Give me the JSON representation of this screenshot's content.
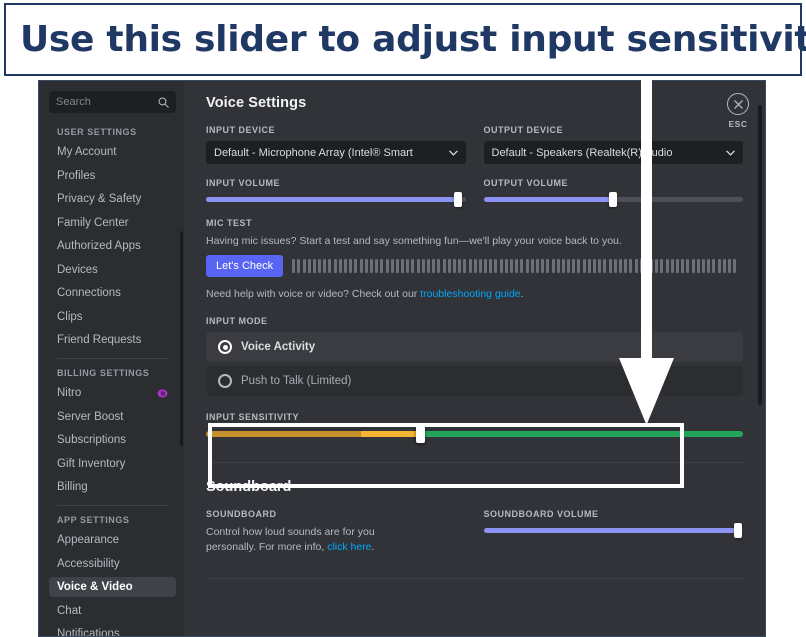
{
  "banner": {
    "text": "Use this slider to adjust input sensitivity"
  },
  "sidebar": {
    "search": {
      "placeholder": "Search",
      "icon": "search-icon"
    },
    "sections": [
      {
        "header": "USER SETTINGS",
        "items": [
          {
            "label": "My Account"
          },
          {
            "label": "Profiles"
          },
          {
            "label": "Privacy & Safety"
          },
          {
            "label": "Family Center"
          },
          {
            "label": "Authorized Apps"
          },
          {
            "label": "Devices"
          },
          {
            "label": "Connections"
          },
          {
            "label": "Clips"
          },
          {
            "label": "Friend Requests"
          }
        ]
      },
      {
        "header": "BILLING SETTINGS",
        "items": [
          {
            "label": "Nitro",
            "badge": "nitro-badge-icon"
          },
          {
            "label": "Server Boost"
          },
          {
            "label": "Subscriptions"
          },
          {
            "label": "Gift Inventory"
          },
          {
            "label": "Billing"
          }
        ]
      },
      {
        "header": "APP SETTINGS",
        "items": [
          {
            "label": "Appearance"
          },
          {
            "label": "Accessibility"
          },
          {
            "label": "Voice & Video",
            "active": true
          },
          {
            "label": "Chat"
          },
          {
            "label": "Notifications"
          }
        ]
      }
    ]
  },
  "esc": {
    "label": "ESC",
    "icon": "close-icon"
  },
  "voice": {
    "title": "Voice Settings",
    "input_device": {
      "label": "INPUT DEVICE",
      "value": "Default - Microphone Array (Intel® Smart"
    },
    "output_device": {
      "label": "OUTPUT DEVICE",
      "value": "Default - Speakers (Realtek(R) Audio"
    },
    "input_volume": {
      "label": "INPUT VOLUME",
      "percent": 97
    },
    "output_volume": {
      "label": "OUTPUT VOLUME",
      "percent": 50
    },
    "mic_test": {
      "label": "MIC TEST",
      "description": "Having mic issues? Start a test and say something fun—we'll play your voice back to you.",
      "button": "Let's Check",
      "help_prefix": "Need help with voice or video? Check out our ",
      "help_link": "troubleshooting guide",
      "help_suffix": "."
    },
    "input_mode": {
      "label": "INPUT MODE",
      "options": [
        {
          "label": "Voice Activity",
          "selected": true
        },
        {
          "label": "Push to Talk (Limited)",
          "selected": false
        }
      ]
    },
    "input_sensitivity": {
      "label": "INPUT SENSITIVITY",
      "percent": 40,
      "colors": {
        "low": "#c8902a",
        "mid": "#f5b431",
        "high": "#23a559"
      }
    }
  },
  "soundboard": {
    "title": "Soundboard",
    "label": "SOUNDBOARD",
    "description_prefix": "Control how loud sounds are for you personally. For more info, ",
    "description_link": "click here",
    "description_suffix": ".",
    "volume": {
      "label": "SOUNDBOARD VOLUME",
      "percent": 98
    }
  },
  "theme": {
    "accent": "#5865f2",
    "slider_fill": "#8d93f4",
    "link": "#00a8fc",
    "banner_color": "#1f3864",
    "bg_sidebar": "#2b2d31",
    "bg_content": "#313338"
  }
}
